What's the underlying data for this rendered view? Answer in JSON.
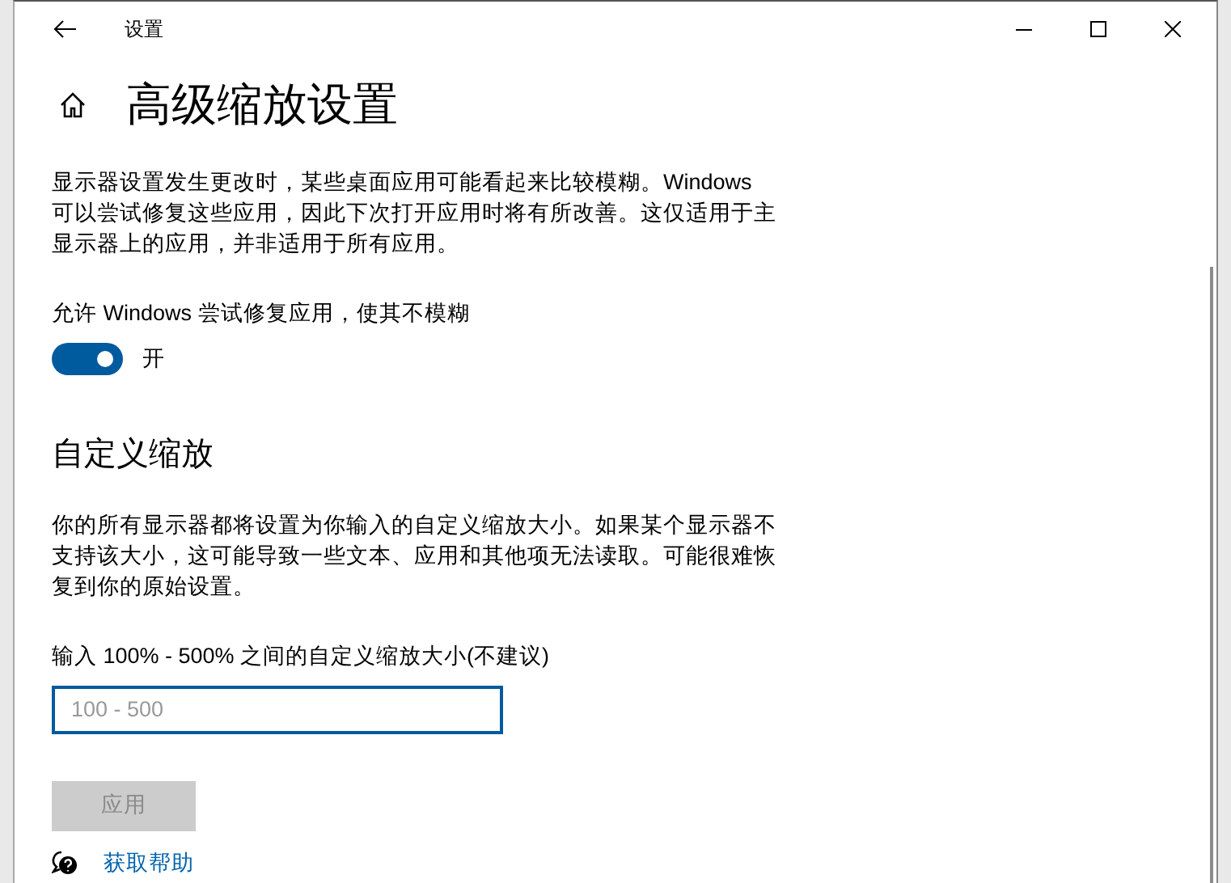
{
  "window": {
    "title": "设置"
  },
  "page": {
    "heading": "高级缩放设置"
  },
  "fix_apps": {
    "description": "显示器设置发生更改时，某些桌面应用可能看起来比较模糊。Windows 可以尝试修复这些应用，因此下次打开应用时将有所改善。这仅适用于主显示器上的应用，并非适用于所有应用。",
    "toggle_label": "允许 Windows 尝试修复应用，使其不模糊",
    "toggle": {
      "on": true,
      "state_text": "开"
    }
  },
  "custom_scaling": {
    "heading": "自定义缩放",
    "description": "你的所有显示器都将设置为你输入的自定义缩放大小。如果某个显示器不支持该大小，这可能导致一些文本、应用和其他项无法读取。可能很难恢复到你的原始设置。",
    "field_label": "输入 100% - 500% 之间的自定义缩放大小(不建议)",
    "field": {
      "placeholder": "100 - 500"
    },
    "apply_button": {
      "label": "应用",
      "disabled": true
    }
  },
  "help_link": "获取帮助"
}
